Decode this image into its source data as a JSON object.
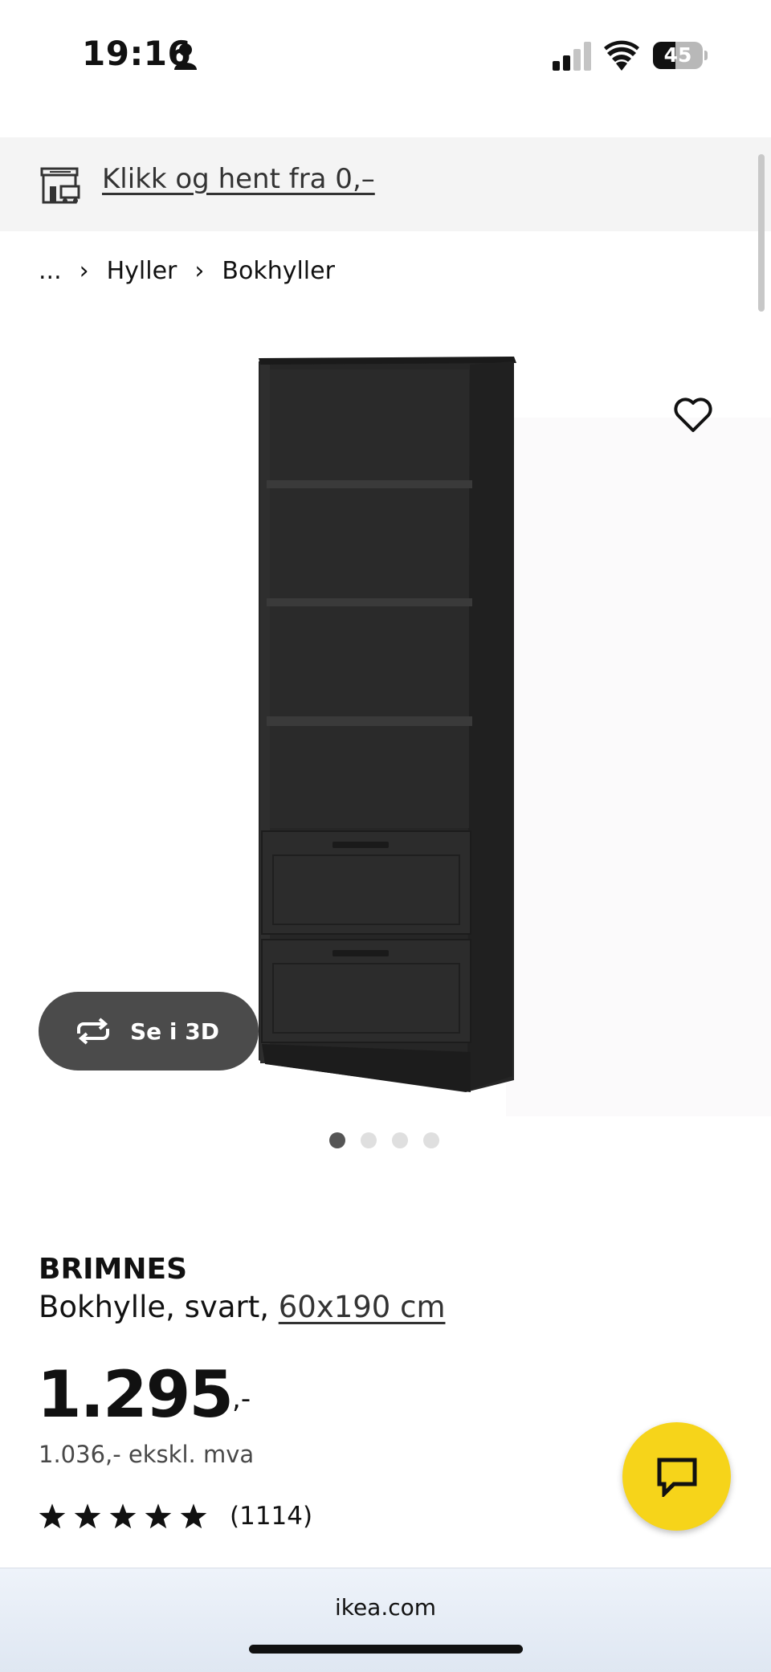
{
  "status_bar": {
    "time": "19:16",
    "battery": "45",
    "battery_level": 0.45,
    "icons": [
      "person-icon",
      "signal-icon",
      "wifi-icon",
      "battery-icon"
    ]
  },
  "banner": {
    "text": "Klikk og hent fra 0,–",
    "icon": "store-icon"
  },
  "breadcrumb": {
    "items": [
      "...",
      "Hyller",
      "Bokhyller"
    ],
    "separator": "›"
  },
  "gallery": {
    "view_3d_label": "Se i 3D",
    "image_count": 4,
    "active_index": 0,
    "favorite_icon": "heart-icon"
  },
  "product": {
    "name": "BRIMNES",
    "description": "Bokhylle, svart, ",
    "size": "60x190 cm",
    "price": "1.295",
    "price_suffix": ",-",
    "price_excl_vat": "1.036,- ekskl. mva",
    "rating_stars": 5,
    "rating_count": "(1114)"
  },
  "chat": {
    "icon": "chat-icon",
    "color": "#f6d41a"
  },
  "browser": {
    "url": "ikea.com"
  }
}
